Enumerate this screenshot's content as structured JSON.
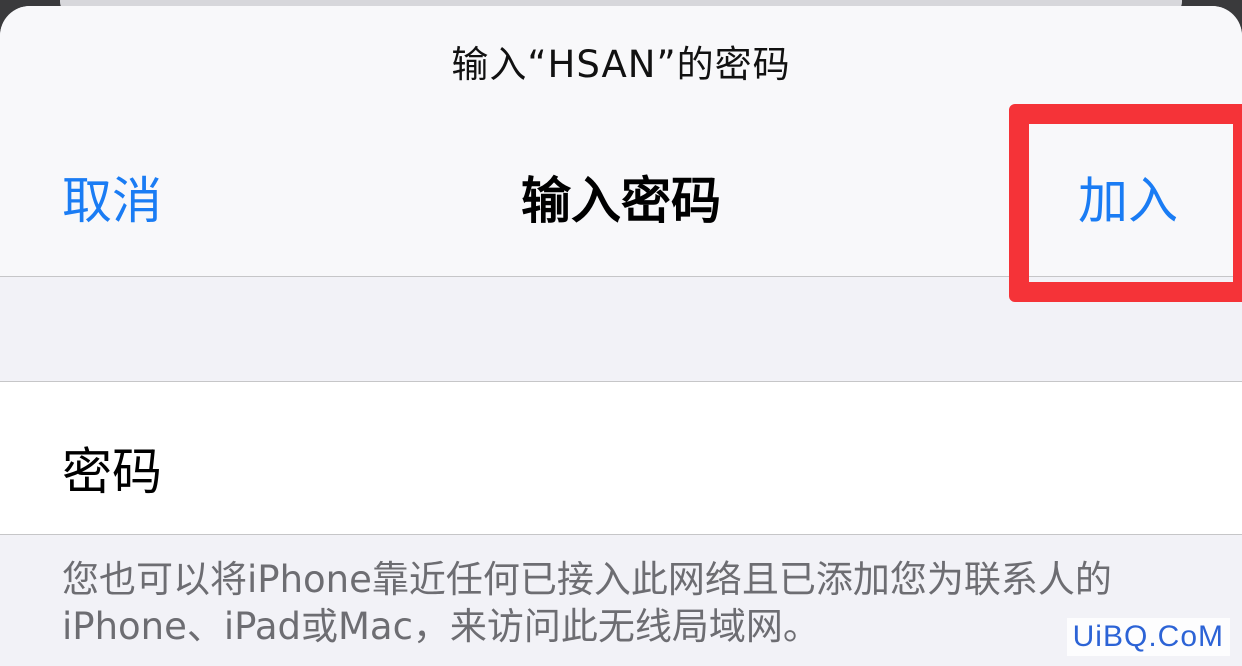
{
  "dialog": {
    "prompt": "输入“HSAN”的密码",
    "title": "输入密码",
    "cancel_label": "取消",
    "join_label": "加入"
  },
  "password_row": {
    "label": "密码",
    "value": "",
    "placeholder": ""
  },
  "footer_note": "您也可以将iPhone靠近任何已接入此网络且已添加您为联系人的iPhone、iPad或Mac，来访问此无线局域网。",
  "watermark": "UiBQ.CoM",
  "colors": {
    "accent": "#1a7cf4",
    "highlight": "#f53338",
    "background": "#f2f2f7",
    "secondary_text": "#6d6d72"
  }
}
